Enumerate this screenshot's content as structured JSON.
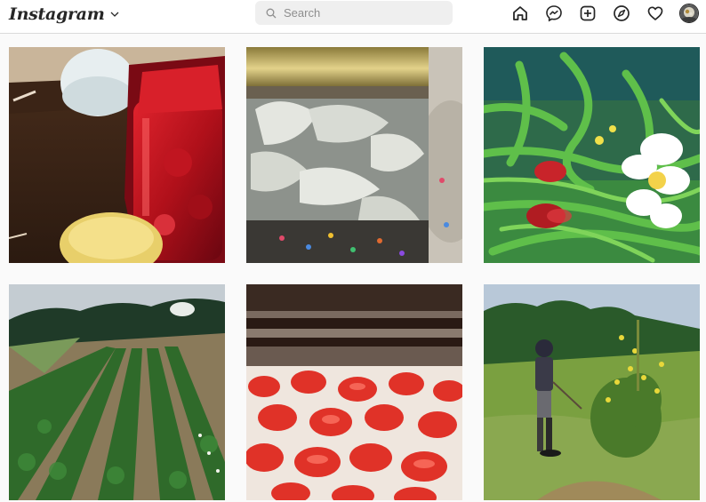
{
  "header": {
    "logo_text": "Instagram",
    "logo_dropdown_icon": "chevron-down-icon",
    "search": {
      "placeholder": "Search",
      "value": ""
    },
    "nav_icons": [
      "home-icon",
      "messenger-icon",
      "new-post-icon",
      "explore-icon",
      "activity-heart-icon",
      "profile-avatar"
    ]
  },
  "grid": {
    "posts": [
      {
        "subject": "jar-of-strawberry-jam"
      },
      {
        "subject": "jar-of-pierogi-dumplings"
      },
      {
        "subject": "garlic-scapes-with-daffodils"
      },
      {
        "subject": "strawberry-field-rows"
      },
      {
        "subject": "sliced-strawberries-in-dehydrator"
      },
      {
        "subject": "child-in-field"
      }
    ]
  },
  "colors": {
    "page_bg": "#fafafa",
    "header_bg": "#ffffff",
    "border": "#dbdbdb",
    "text": "#262626",
    "muted": "#8e8e8e"
  }
}
